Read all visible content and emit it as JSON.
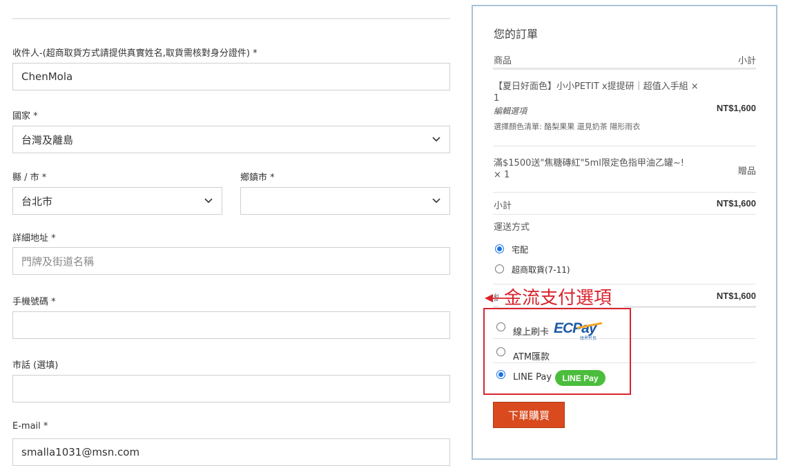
{
  "form": {
    "recipient": {
      "label": "收件人-(超商取貨方式請提供真實姓名,取貨需核對身分證件) *",
      "value": "ChenMola"
    },
    "country": {
      "label": "國家 *",
      "value": "台灣及離島"
    },
    "county": {
      "label": "縣 / 市 *",
      "value": "台北市"
    },
    "town": {
      "label": "鄉鎮市 *",
      "value": ""
    },
    "address": {
      "label": "詳細地址 *",
      "placeholder": "門牌及街道名稱"
    },
    "mobile": {
      "label": "手機號碼 *",
      "value": ""
    },
    "phone": {
      "label": "市話 (選填)",
      "value": ""
    },
    "email": {
      "label": "E-mail *",
      "value": "smalla1031@msn.com"
    }
  },
  "order": {
    "title": "您的訂單",
    "col_product": "商品",
    "col_subtotal": "小計",
    "item1": {
      "name": "【夏日好面色】小小PETIT x提提研｜超值入手組",
      "qty": "× 1",
      "edit": "編輯選項",
      "options": "選擇顏色清單: 酪梨果果 還見奶茶 陽形雨衣",
      "price": "NT$1,600"
    },
    "item2": {
      "name": "滿$1500送\"焦糖磚紅\"5ml限定色指甲油乙罐~!",
      "qty": "× 1",
      "price": "贈品"
    },
    "subtotal_label": "小計",
    "subtotal_value": "NT$1,600",
    "shipping_label": "運送方式",
    "shipping_options": [
      {
        "label": "宅配",
        "selected": true
      },
      {
        "label": "超商取貨(7-11)",
        "selected": false
      }
    ],
    "total_label": "總計",
    "total_value": "NT$1,600",
    "payment_options": [
      {
        "label": "線上刷卡",
        "logo": "ECPay",
        "logo_sub": "綠界科技",
        "selected": false
      },
      {
        "label": "ATM匯款",
        "selected": false
      },
      {
        "label": "LINE Pay",
        "logo": "LINE Pay",
        "selected": true
      }
    ],
    "submit_label": "下單購買"
  },
  "annotation": {
    "text": "金流支付選項",
    "color": "#d9232d"
  }
}
